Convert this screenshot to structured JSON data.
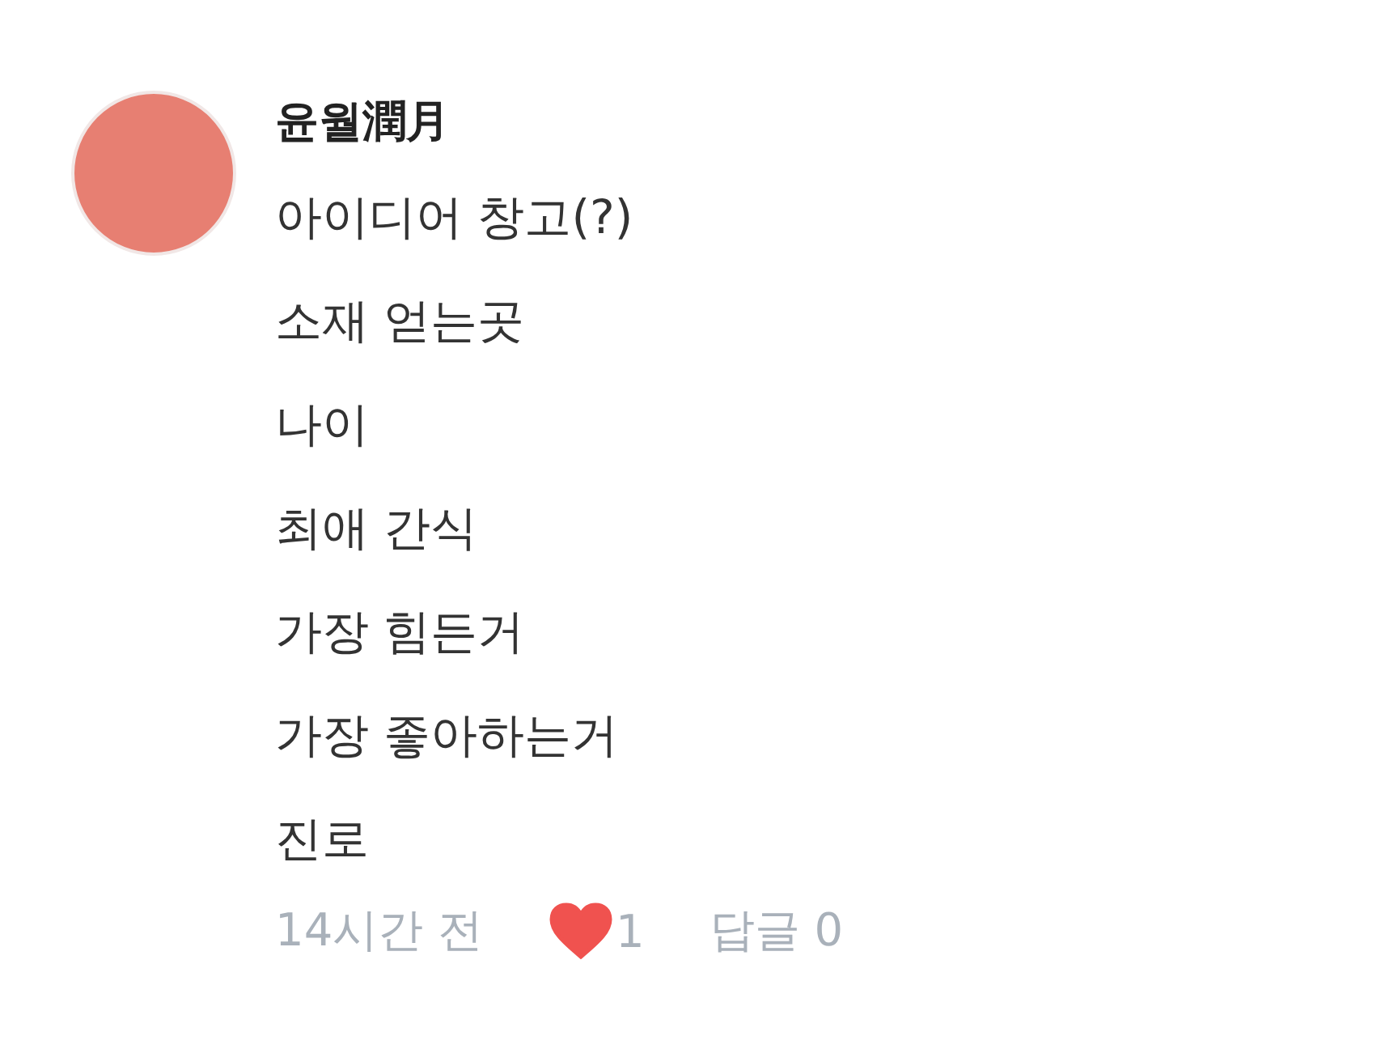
{
  "comment": {
    "author": "윤월潤月",
    "lines": [
      "아이디어 창고(?)",
      "소재 얻는곳",
      "나이",
      "최애 간식",
      "가장 힘든거",
      "가장 좋아하는거",
      "진로"
    ],
    "time": "14시간 전",
    "liked": true,
    "like_count": "1",
    "reply_label": "답글",
    "reply_count": "0"
  }
}
